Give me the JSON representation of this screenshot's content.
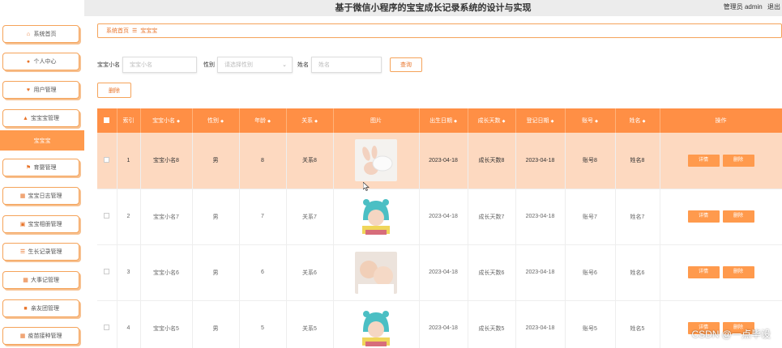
{
  "header": {
    "title": "基于微信小程序的宝宝成长记录系统的设计与实现",
    "user": "管理员 admin",
    "logout": "退出"
  },
  "sidebar": {
    "items": [
      {
        "label": "系统首页",
        "icon": "home-icon"
      },
      {
        "label": "个人中心",
        "icon": "person-icon"
      },
      {
        "label": "用户管理",
        "icon": "user-icon"
      },
      {
        "label": "宝宝宝管理",
        "icon": "baby-icon"
      },
      {
        "label": "育婴管理",
        "icon": "flag-icon"
      },
      {
        "label": "宝宝日志管理",
        "icon": "grid-icon"
      },
      {
        "label": "宝宝相册管理",
        "icon": "album-icon"
      },
      {
        "label": "生长记录管理",
        "icon": "list-icon"
      },
      {
        "label": "大事记管理",
        "icon": "grid-icon"
      },
      {
        "label": "亲友团管理",
        "icon": "group-icon"
      },
      {
        "label": "疫苗接种管理",
        "icon": "grid-icon"
      }
    ],
    "active_sub": "宝宝宝"
  },
  "breadcrumb": {
    "home": "系统首页",
    "sep": "☰",
    "current": "宝宝宝"
  },
  "search": {
    "name_label": "宝宝小名",
    "name_placeholder": "宝宝小名",
    "gender_label": "性别",
    "gender_placeholder": "请选择性别",
    "parent_label": "姓名",
    "parent_placeholder": "姓名",
    "button": "查询"
  },
  "actions": {
    "delete": "删除"
  },
  "table": {
    "headers": [
      "索引",
      "宝宝小名",
      "性别",
      "年龄",
      "关系",
      "图片",
      "出生日期",
      "成长天数",
      "登记日期",
      "账号",
      "姓名",
      "操作"
    ],
    "rows": [
      {
        "index": "1",
        "name": "宝宝小名8",
        "gender": "男",
        "age": "8",
        "relation": "关系8",
        "birth": "2023-04-18",
        "days": "成长天数8",
        "reg": "2023-04-18",
        "account": "账号8",
        "parent": "姓名8"
      },
      {
        "index": "2",
        "name": "宝宝小名7",
        "gender": "男",
        "age": "7",
        "relation": "关系7",
        "birth": "2023-04-18",
        "days": "成长天数7",
        "reg": "2023-04-18",
        "account": "账号7",
        "parent": "姓名7"
      },
      {
        "index": "3",
        "name": "宝宝小名6",
        "gender": "男",
        "age": "6",
        "relation": "关系6",
        "birth": "2023-04-18",
        "days": "成长天数6",
        "reg": "2023-04-18",
        "account": "账号6",
        "parent": "姓名6"
      },
      {
        "index": "4",
        "name": "宝宝小名5",
        "gender": "男",
        "age": "5",
        "relation": "关系5",
        "birth": "2023-04-18",
        "days": "成长天数5",
        "reg": "2023-04-18",
        "account": "账号5",
        "parent": "姓名5"
      }
    ],
    "op_detail": "详情",
    "op_delete": "删除"
  },
  "watermark": "CSDN @一点毕设",
  "colors": {
    "accent": "#ff8f45",
    "highlight_row": "#fdd9c0",
    "border": "#f5a35a"
  }
}
